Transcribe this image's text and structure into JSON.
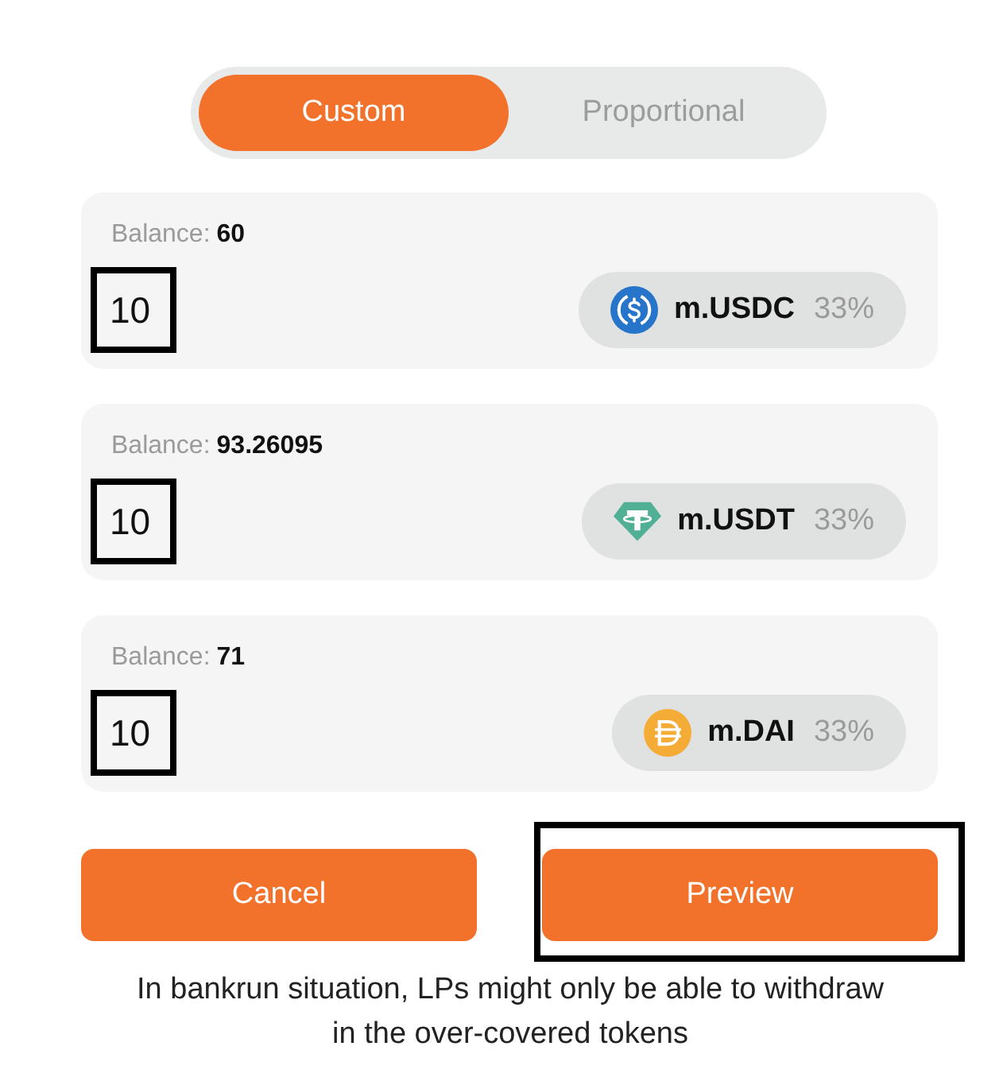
{
  "mode_toggle": {
    "options": [
      {
        "label": "Custom",
        "selected": true
      },
      {
        "label": "Proportional",
        "selected": false
      }
    ]
  },
  "tokens": [
    {
      "balance_label": "Balance:",
      "balance": "60",
      "amount": "10",
      "highlighted": true,
      "kind": "usdc",
      "symbol": "m.USDC",
      "share": "33%"
    },
    {
      "balance_label": "Balance:",
      "balance": "93.26095",
      "amount": "10",
      "highlighted": true,
      "kind": "usdt",
      "symbol": "m.USDT",
      "share": "33%"
    },
    {
      "balance_label": "Balance:",
      "balance": "71",
      "amount": "10",
      "highlighted": true,
      "kind": "dai",
      "symbol": "m.DAI",
      "share": "33%"
    }
  ],
  "buttons": [
    {
      "label": "Cancel",
      "highlighted": false
    },
    {
      "label": "Preview",
      "highlighted": true
    }
  ],
  "note": "In bankrun situation, LPs might only be able to withdraw in the over-covered tokens"
}
